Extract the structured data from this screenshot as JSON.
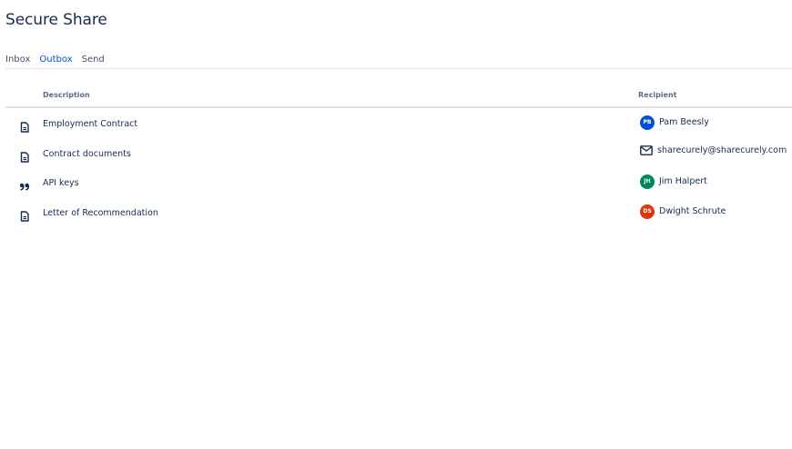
{
  "app": {
    "title": "Secure Share"
  },
  "tabs": [
    {
      "label": "Inbox",
      "active": false
    },
    {
      "label": "Outbox",
      "active": true
    },
    {
      "label": "Send",
      "active": false
    }
  ],
  "table": {
    "headers": {
      "description": "Description",
      "recipient": "Recipient"
    },
    "rows": [
      {
        "icon": "document-icon",
        "description": "Employment Contract",
        "recipient": {
          "type": "user",
          "initials": "PB",
          "name": "Pam Beesly",
          "avatar_color": "#0052cc"
        }
      },
      {
        "icon": "document-icon",
        "description": "Contract documents",
        "recipient": {
          "type": "email",
          "name": "sharecurely@sharecurely.com",
          "icon": "mail-icon"
        }
      },
      {
        "icon": "quote-icon",
        "description": "API keys",
        "recipient": {
          "type": "user",
          "initials": "JH",
          "name": "Jim Halpert",
          "avatar_color": "#00875a"
        }
      },
      {
        "icon": "document-icon",
        "description": "Letter of Recommendation",
        "recipient": {
          "type": "user",
          "initials": "DS",
          "name": "Dwight Schrute",
          "avatar_color": "#de350b"
        }
      }
    ]
  },
  "colors": {
    "text": "#172b4d",
    "muted": "#5e6c84",
    "active_tab": "#0052cc",
    "divider": "#dfe1e6"
  }
}
